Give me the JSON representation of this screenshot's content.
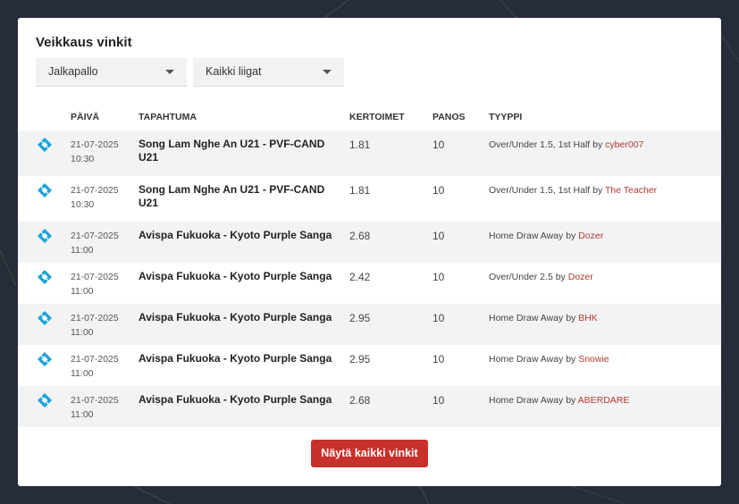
{
  "title": "Veikkaus vinkit",
  "filters": {
    "sport": "Jalkapallo",
    "league": "Kaikki liigat"
  },
  "columns": {
    "date": "PÄIVÄ",
    "event": "TAPAHTUMA",
    "odds": "KERTOIMET",
    "stake": "PANOS",
    "type": "TYYPPI"
  },
  "rows": [
    {
      "date": "21-07-2025",
      "time": "10:30",
      "event": "Song Lam Nghe An U21 - PVF-CAND U21",
      "odds": "1.81",
      "stake": "10",
      "type": "Over/Under 1.5, 1st Half",
      "by": "by",
      "user": "cyber007"
    },
    {
      "date": "21-07-2025",
      "time": "10:30",
      "event": "Song Lam Nghe An U21 - PVF-CAND U21",
      "odds": "1.81",
      "stake": "10",
      "type": "Over/Under 1.5, 1st Half",
      "by": "by",
      "user": "The Teacher"
    },
    {
      "date": "21-07-2025",
      "time": "11:00",
      "event": "Avispa Fukuoka - Kyoto Purple Sanga",
      "odds": "2.68",
      "stake": "10",
      "type": "Home Draw Away",
      "by": "by",
      "user": "Dozer"
    },
    {
      "date": "21-07-2025",
      "time": "11:00",
      "event": "Avispa Fukuoka - Kyoto Purple Sanga",
      "odds": "2.42",
      "stake": "10",
      "type": "Over/Under 2.5",
      "by": "by",
      "user": "Dozer"
    },
    {
      "date": "21-07-2025",
      "time": "11:00",
      "event": "Avispa Fukuoka - Kyoto Purple Sanga",
      "odds": "2.95",
      "stake": "10",
      "type": "Home Draw Away",
      "by": "by",
      "user": "BHK"
    },
    {
      "date": "21-07-2025",
      "time": "11:00",
      "event": "Avispa Fukuoka - Kyoto Purple Sanga",
      "odds": "2.95",
      "stake": "10",
      "type": "Home Draw Away",
      "by": "by",
      "user": "Snowie"
    },
    {
      "date": "21-07-2025",
      "time": "11:00",
      "event": "Avispa Fukuoka - Kyoto Purple Sanga",
      "odds": "2.68",
      "stake": "10",
      "type": "Home Draw Away",
      "by": "by",
      "user": "ABERDARE"
    }
  ],
  "show_all_label": "Näytä kaikki vinkit",
  "colors": {
    "accent": "#c8312b",
    "ticket_icon": "#1ba3d6",
    "username": "#b23a2e",
    "background": "#262c38"
  },
  "icons": {
    "row": "ticket-icon",
    "dropdown": "caret-down-icon"
  }
}
